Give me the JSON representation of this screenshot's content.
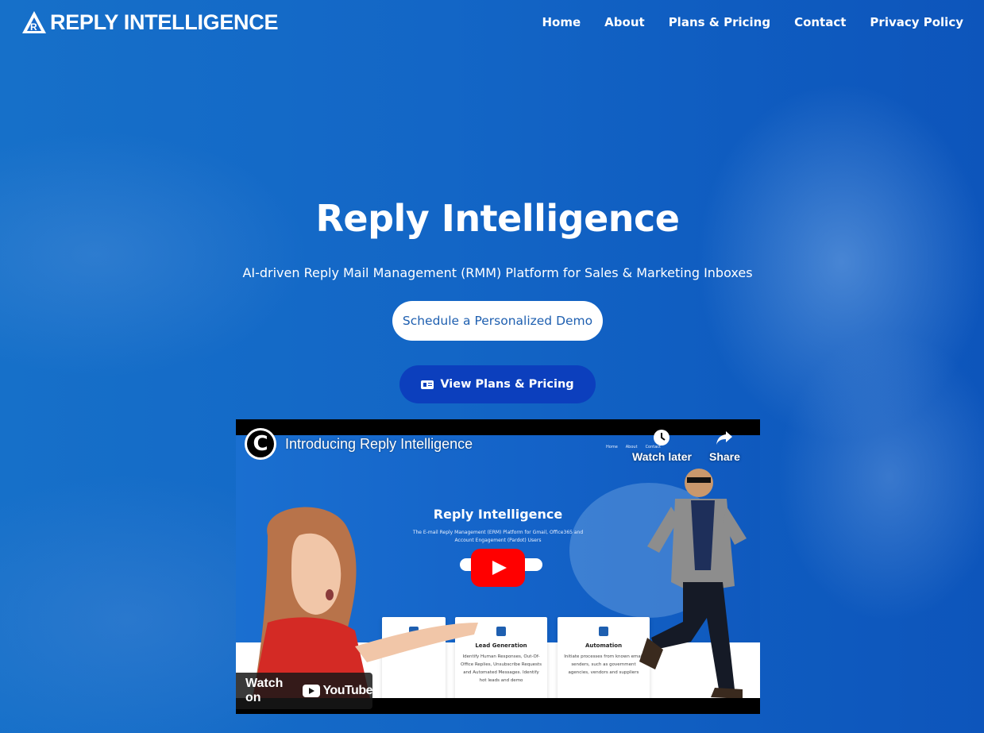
{
  "header": {
    "logo_text": "REPLY INTELLIGENCE",
    "nav": [
      {
        "label": "Home"
      },
      {
        "label": "About"
      },
      {
        "label": "Plans & Pricing"
      },
      {
        "label": "Contact"
      },
      {
        "label": "Privacy Policy"
      }
    ]
  },
  "hero": {
    "title": "Reply Intelligence",
    "subtitle": "AI-driven Reply Mail Management (RMM) Platform for Sales & Marketing Inboxes",
    "demo_button": "Schedule a Personalized Demo",
    "plans_button": "View Plans & Pricing",
    "plans_icon": "pricing-card-icon"
  },
  "video": {
    "channel_letter": "C",
    "title": "Introducing Reply Intelligence",
    "watch_later": "Watch later",
    "share": "Share",
    "watch_on": "Watch on",
    "youtube": "YouTube",
    "thumbnail": {
      "title": "Reply Intelligence",
      "subtitle": "The E-mail Reply Management (ERM) Platform for Gmail, Office365 and Account Engagement (Pardot) Users",
      "nav": [
        "Home",
        "About",
        "Contact"
      ],
      "cards": [
        {
          "title": "Lead Generation",
          "text": "Identify Human Responses, Out-Of-Office Replies, Unsubscribe Requests and Automated Messages. Identify hot leads and demo"
        },
        {
          "title": "Automation",
          "text": "Initiate processes from known email senders, such as government agencies, vendors and suppliers"
        }
      ]
    }
  },
  "colors": {
    "background": "#1565c8",
    "plans_button": "#0c3fbd",
    "demo_text": "#1e5fb0",
    "youtube_red": "#ff0000"
  }
}
